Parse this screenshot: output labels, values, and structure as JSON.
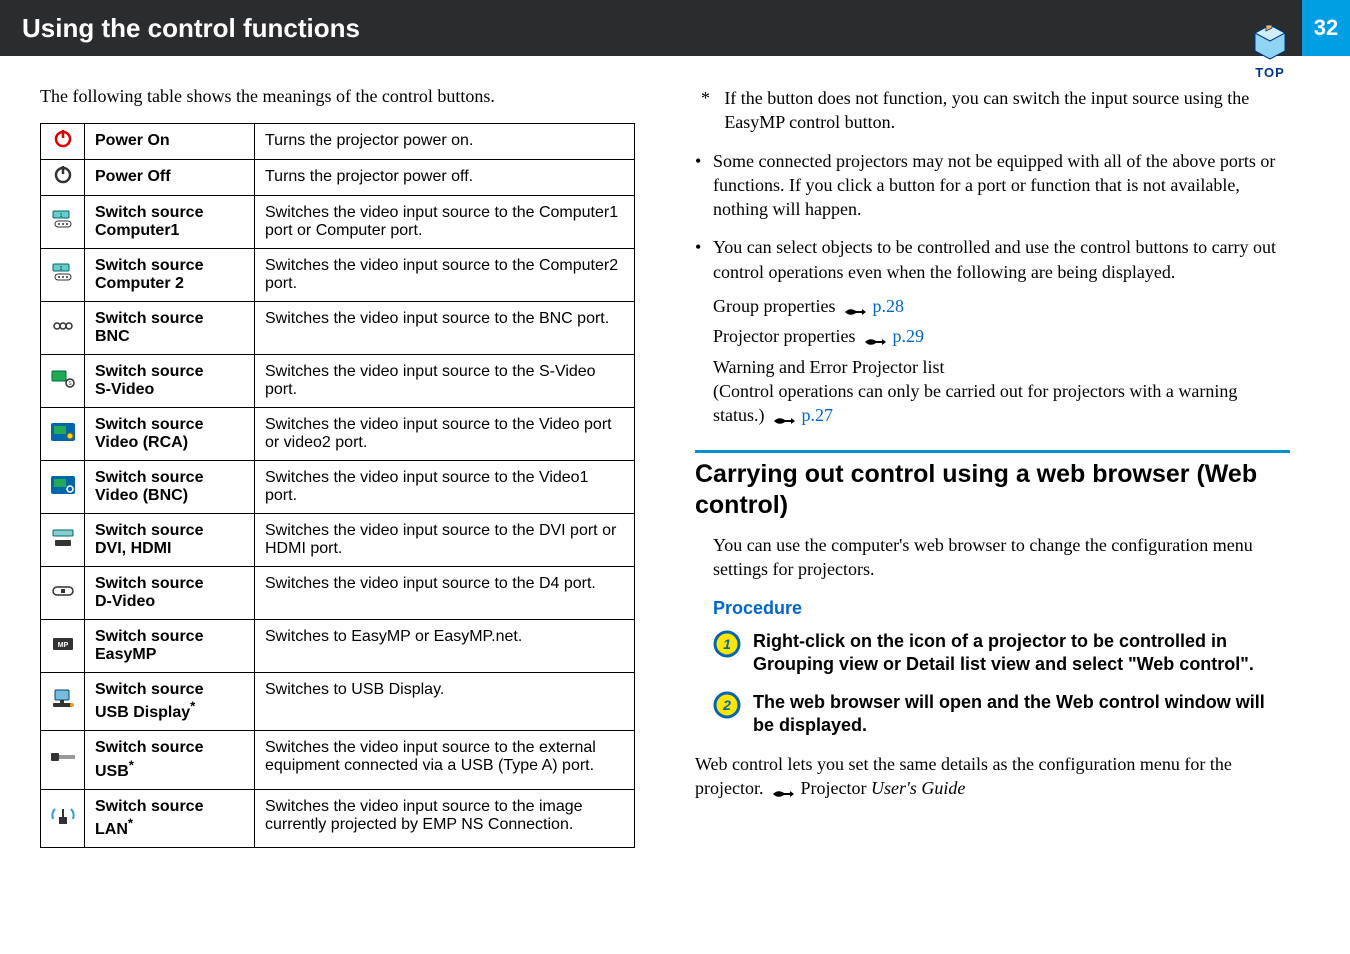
{
  "header": {
    "title": "Using the control functions",
    "page_number": "32",
    "top_label": "TOP"
  },
  "left": {
    "intro": "The following table shows the meanings of the control buttons.",
    "rows": [
      {
        "icon": "power-on",
        "label_html": "<span class='labeltop'>Power On</span>",
        "desc": "Turns the projector power on."
      },
      {
        "icon": "power-off",
        "label_html": "<span class='labeltop'>Power Off</span>",
        "desc": "Turns the projector power off."
      },
      {
        "icon": "comp1",
        "label_html": "<span class='labeltop'>Switch source<br>Computer1</span>",
        "desc": "Switches the video input source to the Computer1 port or Computer port."
      },
      {
        "icon": "comp2",
        "label_html": "<span class='labeltop'>Switch source<br>Computer 2</span>",
        "desc": "Switches the video input source to the Computer2 port."
      },
      {
        "icon": "bnc",
        "label_html": "<span class='labeltop'>Switch source<br>BNC</span>",
        "desc": "Switches the video input source to the BNC port."
      },
      {
        "icon": "svideo",
        "label_html": "<span class='labeltop'>Switch source<br>S-Video</span>",
        "desc": "Switches the video input source to the S-Video port."
      },
      {
        "icon": "rca",
        "label_html": "<span class='labeltop'>Switch source<br>Video (RCA)</span>",
        "desc": "Switches the video input source to the Video port or video2 port."
      },
      {
        "icon": "vbnc",
        "label_html": "<span class='labeltop'>Switch source<br>Video (BNC)</span>",
        "desc": "Switches the video input source to the Video1 port."
      },
      {
        "icon": "dvi",
        "label_html": "<span class='labeltop'>Switch source<br>DVI, HDMI</span>",
        "desc": "Switches the video input source to the DVI port or HDMI port."
      },
      {
        "icon": "d4",
        "label_html": "<span class='labeltop'>Switch source<br>D-Video</span>",
        "desc": "Switches the video input source to the D4 port."
      },
      {
        "icon": "mp",
        "label_html": "<span class='labeltop'>Switch source<br>EasyMP</span>",
        "desc": "Switches to EasyMP or EasyMP.net."
      },
      {
        "icon": "usbdisp",
        "label_html": "<span class='labeltop'>Switch source<br>USB Display<sup>*</sup></span>",
        "desc": "Switches to USB Display."
      },
      {
        "icon": "usb",
        "label_html": "<span class='labeltop'>Switch source<br>USB<sup>*</sup></span>",
        "desc": "Switches the video input source to the external equipment connected via a USB (Type A) port."
      },
      {
        "icon": "lan",
        "label_html": "<span class='labeltop'>Switch source<br>LAN<sup>*</sup></span>",
        "desc": "Switches the video input source to the image currently projected by EMP NS Connection."
      }
    ]
  },
  "right": {
    "footnote": "If the button does not function, you can switch the input source using the EasyMP control button.",
    "bullet1": "Some connected projectors may not be equipped with all of the above ports or functions. If you click a button for a port or function that is not available, nothing will happen.",
    "bullet2": "You can select objects to be controlled and use the control buttons to carry out control operations even when the following are being displayed.",
    "sub_group": "Group properties",
    "sub_group_link": "p.28",
    "sub_proj": "Projector properties",
    "sub_proj_link": "p.29",
    "sub_warn1": "Warning and Error Projector list",
    "sub_warn2_a": "(Control operations can only be carried out for projectors with a warning status.)",
    "sub_warn_link": "p.27",
    "section_heading": "Carrying out control using a web browser (Web control)",
    "section_intro": "You can use the computer's web browser to change the configuration menu settings for projectors.",
    "procedure_label": "Procedure",
    "step1": "Right-click on the icon of a projector to be controlled in Grouping view or Detail list view and select \"Web control\".",
    "step2": "The web browser will open and the Web control window will be displayed.",
    "closing_a": "Web control lets you set the same details as the configuration menu for the projector.",
    "closing_b": "Projector",
    "closing_c": "User's Guide"
  }
}
